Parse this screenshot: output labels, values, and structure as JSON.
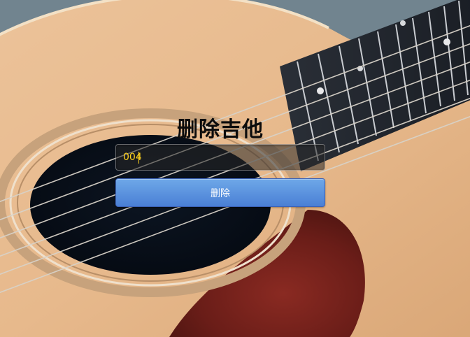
{
  "page": {
    "title": "删除吉他"
  },
  "form": {
    "id_value": "004",
    "submit_label": "删除"
  },
  "colors": {
    "input_text": "#ffd21c",
    "button_top": "#6ea8e8",
    "button_bottom": "#4a7fd5"
  },
  "background": {
    "subject": "acoustic-guitar-photo"
  }
}
